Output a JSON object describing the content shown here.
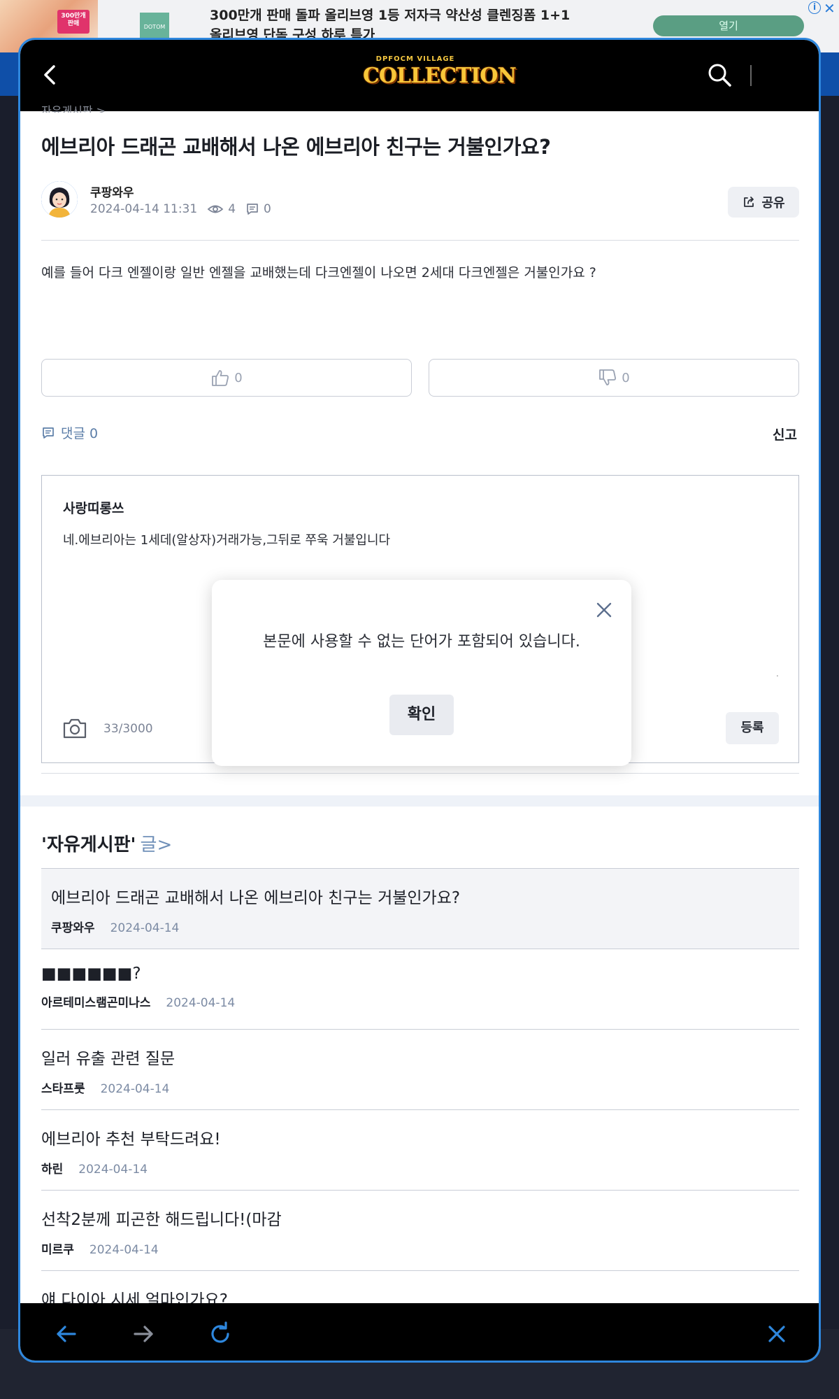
{
  "ad": {
    "thumb_badge": "300만개\n판매",
    "logo_text": "DOTOM",
    "headline": "300만개 판매 돌파 올리브영 1등 저자극 약산성 클렌징폼 1+1",
    "subline": "올리브영 단독 구성 하루 특가",
    "cta": "열기",
    "info": "i",
    "close": "✕"
  },
  "header": {
    "logo_top": "DPFOCM VILLAGE",
    "logo_main": "COLLECTION"
  },
  "article": {
    "breadcrumb": "자유게시판 >",
    "title": "에브리아 드래곤 교배해서 나온 에브리아 친구는 거불인가요?",
    "author": "쿠팡와우",
    "date": "2024-04-14 11:31",
    "views": "4",
    "comments": "0",
    "share_label": "공유",
    "body": "예를 들어 다크 엔젤이랑 일반 엔젤을 교배했는데 다크엔젤이 나오면 2세대 다크엔젤은 거불인가요 ?",
    "likes": "0",
    "dislikes": "0",
    "comment_count_label": "댓글 0",
    "report_label": "신고"
  },
  "comment_editor": {
    "commenter": "사랑띠롱쓰",
    "text": "네.에브리아는 1세데(알상자)거래가능,그뒤로 쭈욱 거불입니다",
    "dot": ".",
    "char_count": "33/3000",
    "submit_label": "등록"
  },
  "dialog": {
    "message": "본문에 사용할 수 없는 단어가 포함되어 있습니다.",
    "ok_label": "확인"
  },
  "board": {
    "name": "'자유게시판'",
    "more": "글>",
    "posts": [
      {
        "title": "에브리아 드래곤 교배해서 나온 에브리아 친구는 거불인가요?",
        "author": "쿠팡와우",
        "date": "2024-04-14"
      },
      {
        "title": "■■■■■■?",
        "author": "아르테미스램곤미나스",
        "date": "2024-04-14"
      },
      {
        "title": "일러 유출 관련 질문",
        "author": "스타프룻",
        "date": "2024-04-14"
      },
      {
        "title": "에브리아 추천 부탁드려요!",
        "author": "하린",
        "date": "2024-04-14"
      },
      {
        "title": "선착2분께 피곤한 해드립니다!(마감",
        "author": "미르쿠",
        "date": "2024-04-14"
      },
      {
        "title": "얘 다이아 시세 얼마인가요?",
        "author": "",
        "date": ""
      }
    ]
  },
  "colors": {
    "panel_border": "#2e87dd",
    "header_bg": "#000000",
    "accent_link": "#5c7ea8",
    "date_text": "#7c8ba4",
    "nav_icon": "#2e87dd"
  }
}
